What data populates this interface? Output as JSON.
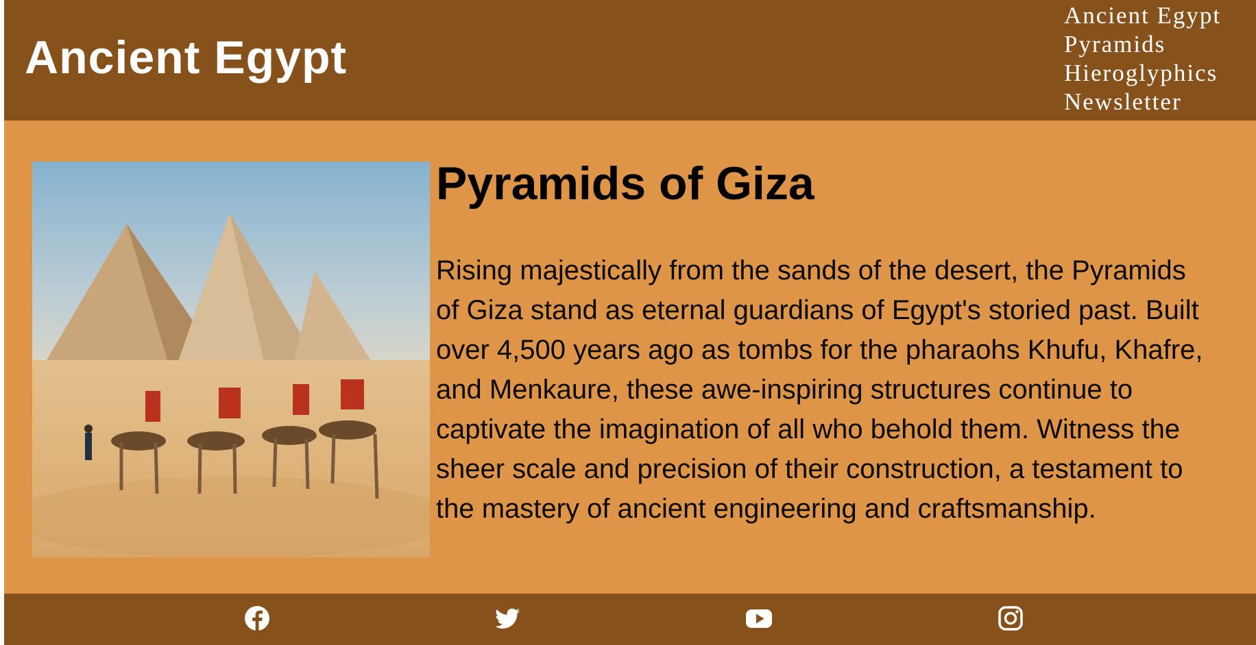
{
  "header": {
    "title": "Ancient Egypt",
    "nav": [
      "Ancient Egypt",
      "Pyramids",
      "Hieroglyphics",
      "Newsletter"
    ]
  },
  "article": {
    "image_alt": "Camel caravan in front of the Pyramids of Giza",
    "title": "Pyramids of Giza",
    "body": "Rising majestically from the sands of the desert, the Pyramids of Giza stand as eternal guardians of Egypt's storied past. Built over 4,500 years ago as tombs for the pharaohs Khufu, Khafre, and Menkaure, these awe-inspiring structures continue to captivate the imagination of all who behold them. Witness the sheer scale and precision of their construction, a testament to the mastery of ancient engineering and craftsmanship."
  },
  "footer": {
    "social": [
      {
        "name": "facebook-icon"
      },
      {
        "name": "twitter-icon"
      },
      {
        "name": "youtube-icon"
      },
      {
        "name": "instagram-icon"
      }
    ]
  },
  "colors": {
    "header_bg": "#86511a",
    "page_bg": "#df9548",
    "text_light": "#ffffff",
    "text_dark": "#000000"
  }
}
